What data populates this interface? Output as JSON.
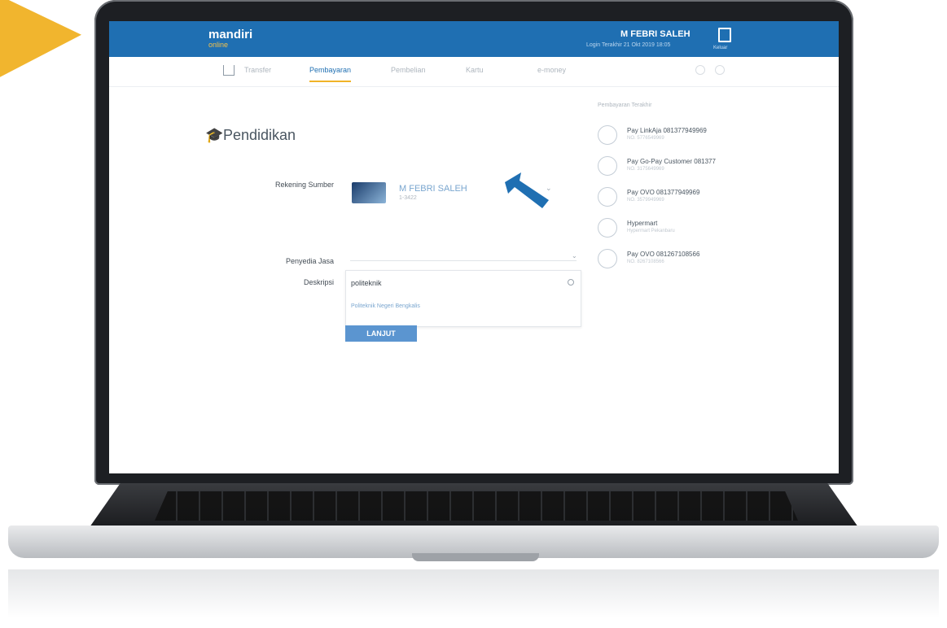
{
  "header": {
    "logo": "mandiri",
    "logo_sub": "online",
    "user_name": "M FEBRI SALEH",
    "last_login": "Login Terakhir 21 Okt 2019 18:05",
    "logout_label": "Keluar"
  },
  "nav": {
    "items": [
      "Transfer",
      "Pembayaran",
      "Pembelian",
      "Kartu",
      "e-money"
    ],
    "active": "Pembayaran"
  },
  "page": {
    "title": "Pendidikan"
  },
  "form": {
    "source_label": "Rekening Sumber",
    "account_name": "M FEBRI SALEH",
    "account_number": "1-3422",
    "provider_label": "Penyedia Jasa",
    "description_label": "Deskripsi",
    "search_query": "politeknik",
    "result_title": "Politeknik Negeri Bengkalis",
    "submit_label": "LANJUT"
  },
  "recent": {
    "title": "Pembayaran Terakhir",
    "items": [
      {
        "name": "Pay LinkAja 081377949969",
        "sub": "NO. 5776549969"
      },
      {
        "name": "Pay Go-Pay Customer 081377",
        "sub": "NO. 3175649969"
      },
      {
        "name": "Pay OVO 081377949969",
        "sub": "NO. 3579949969"
      },
      {
        "name": "Hypermart",
        "sub": "Hypermart Pekanbaru"
      },
      {
        "name": "Pay OVO 081267108566",
        "sub": "NO. 8267108566"
      }
    ]
  }
}
